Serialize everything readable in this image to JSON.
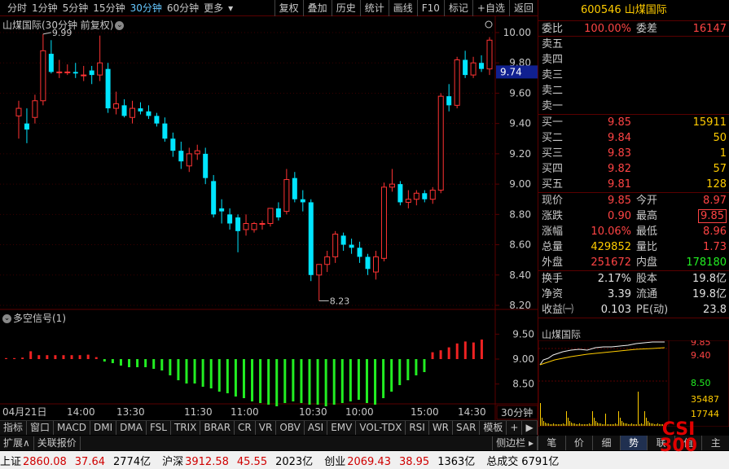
{
  "toolbar": {
    "periods": [
      "分时",
      "1分钟",
      "5分钟",
      "15分钟",
      "30分钟",
      "60分钟",
      "更多"
    ],
    "active_period": "30分钟",
    "buttons": [
      "复权",
      "叠加",
      "历史",
      "统计",
      "画线",
      "F10",
      "标记",
      "+自选",
      "返回"
    ]
  },
  "chart": {
    "title": "山煤国际(30分钟 前复权)",
    "high_label": "9.99",
    "low_label": "8.23",
    "current_price_tag": "9.74",
    "price_ticks": [
      "10.00",
      "9.80",
      "9.60",
      "9.40",
      "9.20",
      "9.00",
      "8.80",
      "8.60",
      "8.40",
      "8.20"
    ],
    "indicator_title": "多空信号(1)",
    "indicator_ticks": [
      "9.50",
      "9.00",
      "8.50"
    ],
    "time_labels": [
      "04月21日",
      "14:00",
      "13:30",
      "11:30",
      "11:00",
      "10:30",
      "10:00",
      "15:00",
      "14:30"
    ],
    "period_label": "30分钟",
    "colors": {
      "up": "#ff3333",
      "down": "#00e5ff",
      "signal_up": "#ee2222",
      "signal_down": "#22ee22",
      "grid": "#5a0000"
    }
  },
  "chart_data": {
    "type": "candlestick",
    "title": "山煤国际(30分钟 前复权)",
    "candles": [
      {
        "o": 9.45,
        "h": 9.55,
        "l": 9.3,
        "c": 9.5
      },
      {
        "o": 9.4,
        "h": 9.5,
        "l": 9.27,
        "c": 9.36
      },
      {
        "o": 9.44,
        "h": 9.59,
        "l": 9.4,
        "c": 9.55
      },
      {
        "o": 9.55,
        "h": 9.99,
        "l": 9.52,
        "c": 9.88
      },
      {
        "o": 9.86,
        "h": 9.95,
        "l": 9.73,
        "c": 9.74
      },
      {
        "o": 9.74,
        "h": 9.82,
        "l": 9.7,
        "c": 9.74
      },
      {
        "o": 9.74,
        "h": 9.79,
        "l": 9.72,
        "c": 9.74
      },
      {
        "o": 9.74,
        "h": 9.8,
        "l": 9.7,
        "c": 9.73
      },
      {
        "o": 9.72,
        "h": 9.78,
        "l": 9.68,
        "c": 9.72
      },
      {
        "o": 9.75,
        "h": 9.78,
        "l": 9.66,
        "c": 9.72
      },
      {
        "o": 9.72,
        "h": 9.98,
        "l": 9.68,
        "c": 9.8
      },
      {
        "o": 9.76,
        "h": 9.8,
        "l": 9.47,
        "c": 9.5
      },
      {
        "o": 9.5,
        "h": 9.61,
        "l": 9.46,
        "c": 9.53
      },
      {
        "o": 9.52,
        "h": 9.56,
        "l": 9.44,
        "c": 9.45
      },
      {
        "o": 9.44,
        "h": 9.55,
        "l": 9.4,
        "c": 9.5
      },
      {
        "o": 9.5,
        "h": 9.54,
        "l": 9.46,
        "c": 9.48
      },
      {
        "o": 9.48,
        "h": 9.52,
        "l": 9.43,
        "c": 9.45
      },
      {
        "o": 9.45,
        "h": 9.47,
        "l": 9.38,
        "c": 9.4
      },
      {
        "o": 9.4,
        "h": 9.44,
        "l": 9.28,
        "c": 9.3
      },
      {
        "o": 9.3,
        "h": 9.34,
        "l": 9.18,
        "c": 9.22
      },
      {
        "o": 9.22,
        "h": 9.28,
        "l": 9.1,
        "c": 9.15
      },
      {
        "o": 9.12,
        "h": 9.24,
        "l": 9.08,
        "c": 9.2
      },
      {
        "o": 9.2,
        "h": 9.26,
        "l": 9.16,
        "c": 9.22
      },
      {
        "o": 9.2,
        "h": 9.24,
        "l": 9.0,
        "c": 9.04
      },
      {
        "o": 9.02,
        "h": 9.06,
        "l": 8.78,
        "c": 8.8
      },
      {
        "o": 8.84,
        "h": 8.9,
        "l": 8.74,
        "c": 8.82
      },
      {
        "o": 8.8,
        "h": 8.84,
        "l": 8.7,
        "c": 8.74
      },
      {
        "o": 8.78,
        "h": 8.8,
        "l": 8.55,
        "c": 8.69
      },
      {
        "o": 8.7,
        "h": 8.8,
        "l": 8.66,
        "c": 8.74
      },
      {
        "o": 8.7,
        "h": 8.75,
        "l": 8.68,
        "c": 8.74
      },
      {
        "o": 8.74,
        "h": 8.76,
        "l": 8.7,
        "c": 8.74
      },
      {
        "o": 8.74,
        "h": 8.84,
        "l": 8.72,
        "c": 8.84
      },
      {
        "o": 8.84,
        "h": 8.88,
        "l": 8.76,
        "c": 8.78
      },
      {
        "o": 8.82,
        "h": 9.1,
        "l": 8.8,
        "c": 9.03
      },
      {
        "o": 9.04,
        "h": 9.08,
        "l": 8.88,
        "c": 8.9
      },
      {
        "o": 8.9,
        "h": 8.96,
        "l": 8.82,
        "c": 8.88
      },
      {
        "o": 8.88,
        "h": 8.9,
        "l": 8.36,
        "c": 8.4
      },
      {
        "o": 8.4,
        "h": 8.47,
        "l": 8.23,
        "c": 8.47
      },
      {
        "o": 8.47,
        "h": 8.56,
        "l": 8.42,
        "c": 8.52
      },
      {
        "o": 8.52,
        "h": 8.69,
        "l": 8.48,
        "c": 8.67
      },
      {
        "o": 8.66,
        "h": 8.68,
        "l": 8.56,
        "c": 8.6
      },
      {
        "o": 8.6,
        "h": 8.64,
        "l": 8.54,
        "c": 8.58
      },
      {
        "o": 8.58,
        "h": 8.62,
        "l": 8.48,
        "c": 8.52
      },
      {
        "o": 8.52,
        "h": 8.54,
        "l": 8.4,
        "c": 8.44
      },
      {
        "o": 8.42,
        "h": 8.56,
        "l": 8.37,
        "c": 8.52
      },
      {
        "o": 8.51,
        "h": 9.01,
        "l": 8.49,
        "c": 8.98
      },
      {
        "o": 8.98,
        "h": 9.1,
        "l": 8.95,
        "c": 9.0
      },
      {
        "o": 9.0,
        "h": 9.02,
        "l": 8.86,
        "c": 8.88
      },
      {
        "o": 8.88,
        "h": 8.96,
        "l": 8.84,
        "c": 8.9
      },
      {
        "o": 8.9,
        "h": 8.96,
        "l": 8.86,
        "c": 8.94
      },
      {
        "o": 8.94,
        "h": 8.96,
        "l": 8.88,
        "c": 8.9
      },
      {
        "o": 8.9,
        "h": 8.98,
        "l": 8.87,
        "c": 8.96
      },
      {
        "o": 8.96,
        "h": 9.6,
        "l": 8.94,
        "c": 9.58
      },
      {
        "o": 9.58,
        "h": 9.66,
        "l": 9.48,
        "c": 9.52
      },
      {
        "o": 9.52,
        "h": 9.84,
        "l": 9.5,
        "c": 9.82
      },
      {
        "o": 9.82,
        "h": 9.88,
        "l": 9.7,
        "c": 9.72
      },
      {
        "o": 9.72,
        "h": 9.84,
        "l": 9.7,
        "c": 9.8
      },
      {
        "o": 9.8,
        "h": 9.85,
        "l": 9.74,
        "c": 9.76
      },
      {
        "o": 9.76,
        "h": 9.97,
        "l": 9.72,
        "c": 9.95
      }
    ],
    "signal_up": [
      true,
      true,
      true,
      true,
      true,
      true,
      true,
      true,
      true,
      true,
      true,
      true,
      false,
      false,
      false,
      false,
      false,
      false,
      false,
      false,
      false,
      false,
      false,
      false,
      false,
      false,
      false,
      false,
      false,
      false,
      false,
      false,
      false,
      false,
      false,
      false,
      false,
      false,
      false,
      false,
      false,
      false,
      false,
      false,
      false,
      false,
      false,
      false,
      false,
      false,
      false,
      false,
      true,
      true,
      true,
      true,
      true,
      true,
      true
    ],
    "signal_len": [
      2,
      2,
      3,
      16,
      8,
      8,
      8,
      8,
      8,
      8,
      9,
      4,
      3,
      5,
      8,
      10,
      10,
      10,
      12,
      14,
      20,
      26,
      30,
      30,
      34,
      36,
      40,
      42,
      46,
      48,
      52,
      54,
      56,
      58,
      54,
      52,
      54,
      56,
      56,
      58,
      56,
      54,
      52,
      50,
      54,
      56,
      48,
      40,
      32,
      26,
      20,
      16,
      14,
      18,
      24,
      32,
      36,
      34,
      40
    ],
    "ylim": [
      8.2,
      10.0
    ],
    "signal_ticks": [
      9.5,
      9.0,
      8.5
    ]
  },
  "quote": {
    "code": "600546",
    "name": "山煤国际",
    "weibi_label": "委比",
    "weibi": "100.00%",
    "weicha_label": "委差",
    "weicha": "16147",
    "asks": [
      {
        "label": "卖五",
        "price": "",
        "vol": ""
      },
      {
        "label": "卖四",
        "price": "",
        "vol": ""
      },
      {
        "label": "卖三",
        "price": "",
        "vol": ""
      },
      {
        "label": "卖二",
        "price": "",
        "vol": ""
      },
      {
        "label": "卖一",
        "price": "",
        "vol": ""
      }
    ],
    "bids": [
      {
        "label": "买一",
        "price": "9.85",
        "vol": "15911"
      },
      {
        "label": "买二",
        "price": "9.84",
        "vol": "50"
      },
      {
        "label": "买三",
        "price": "9.83",
        "vol": "1"
      },
      {
        "label": "买四",
        "price": "9.82",
        "vol": "57"
      },
      {
        "label": "买五",
        "price": "9.81",
        "vol": "128"
      }
    ],
    "stats": [
      {
        "l1": "现价",
        "v1": "9.85",
        "k1": "red",
        "l2": "今开",
        "v2": "8.97",
        "k2": "red"
      },
      {
        "l1": "涨跌",
        "v1": "0.90",
        "k1": "red",
        "l2": "最高",
        "v2": "9.85",
        "k2": "red",
        "boxed": true
      },
      {
        "l1": "涨幅",
        "v1": "10.06%",
        "k1": "red",
        "l2": "最低",
        "v2": "8.96",
        "k2": "red"
      },
      {
        "l1": "总量",
        "v1": "429852",
        "k1": "yel",
        "l2": "量比",
        "v2": "1.73",
        "k2": "red"
      },
      {
        "l1": "外盘",
        "v1": "251672",
        "k1": "red",
        "l2": "内盘",
        "v2": "178180",
        "k2": "green"
      }
    ],
    "stats2": [
      {
        "l1": "换手",
        "v1": "2.17%",
        "l2": "股本",
        "v2": "19.8亿"
      },
      {
        "l1": "净资",
        "v1": "3.39",
        "l2": "流通",
        "v2": "19.8亿"
      },
      {
        "l1": "收益㈠",
        "v1": "0.103",
        "l2": "PE(动)",
        "v2": "23.8"
      }
    ],
    "mini_title": "山煤国际",
    "mini_ticks": [
      "9.85",
      "9.40",
      "8.50",
      "35487",
      "17744"
    ]
  },
  "bottom_tabs": [
    "指标",
    "窗口",
    "MACD",
    "DMI",
    "DMA",
    "FSL",
    "TRIX",
    "BRAR",
    "CR",
    "VR",
    "OBV",
    "ASI",
    "EMV",
    "VOL-TDX",
    "RSI",
    "WR",
    "SAR",
    "模板",
    "+",
    "▶"
  ],
  "bottom_tabs2": [
    "扩展∧",
    "关联报价"
  ],
  "side_collapse": "侧边栏 ▸",
  "side_tabs": [
    "笔",
    "价",
    "细",
    "势",
    "联",
    "值",
    "主"
  ],
  "side_active": "势",
  "status": [
    {
      "name": "上证",
      "val": "2860.08",
      "chg": "37.64",
      "amt": "2774亿"
    },
    {
      "name": "沪深",
      "val": "3912.58",
      "chg": "45.55",
      "amt": "2023亿"
    },
    {
      "name": "创业",
      "val": "2069.43",
      "chg": "38.95",
      "amt": "1363亿"
    }
  ],
  "total_label": "总成交",
  "total_val": "6791亿",
  "logo_text": "CSI 300"
}
